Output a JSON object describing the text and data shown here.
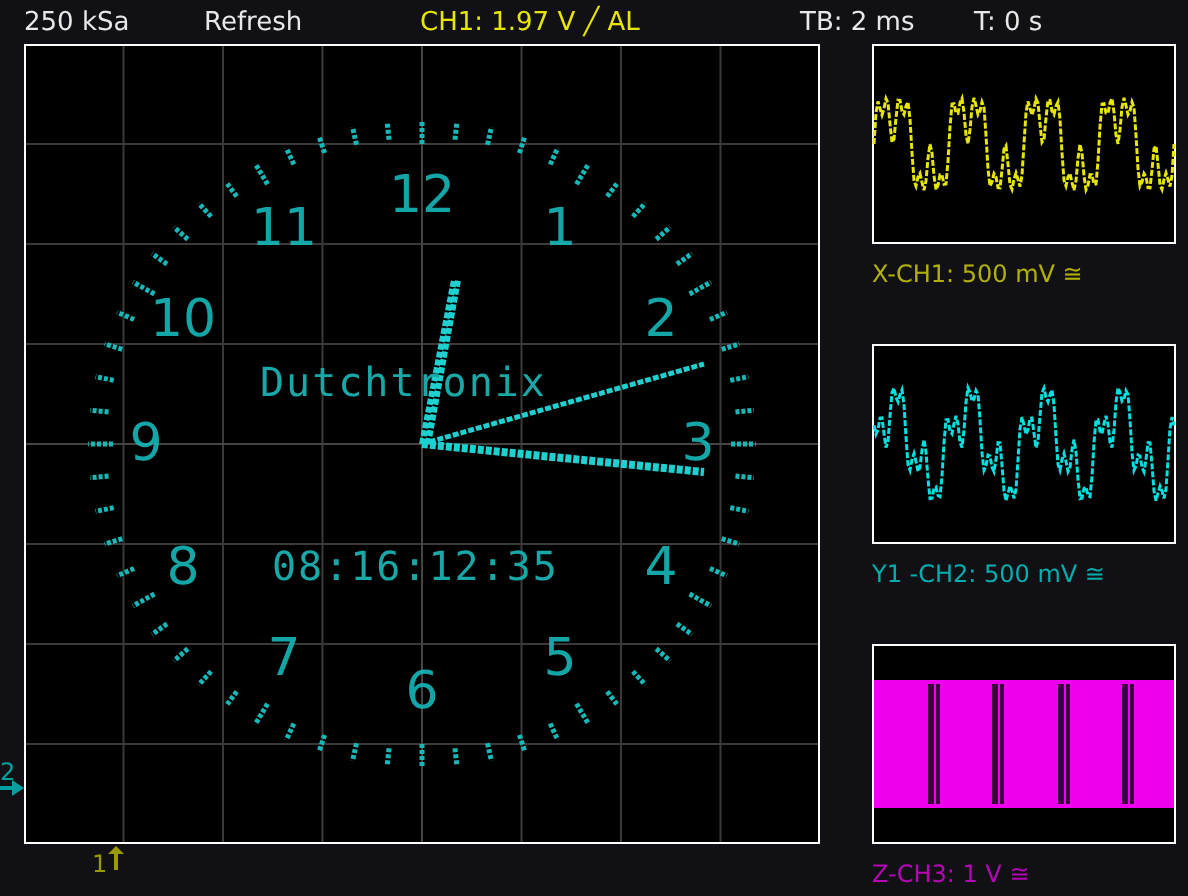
{
  "status_bar": [
    {
      "text": "250 kSa",
      "color": "#e8e8e8"
    },
    {
      "text": "Refresh",
      "color": "#e8e8e8"
    },
    {
      "text": "CH1: 1.97 V ╱ AL",
      "color": "#e6e600"
    },
    {
      "text": "TB: 2 ms",
      "color": "#e8e8e8"
    },
    {
      "text": "T: 0 s",
      "color": "#e8e8e8"
    }
  ],
  "xy_display": {
    "numerals": [
      "1",
      "2",
      "3",
      "4",
      "5",
      "6",
      "7",
      "8",
      "9",
      "10",
      "11",
      "12"
    ],
    "brand": "Dutchtronix",
    "time": "08:16:12:35"
  },
  "channels": [
    {
      "label": "X-CH1: 500 mV ≅",
      "color": "#e6e600",
      "kind": "wave"
    },
    {
      "label": "Y1 -CH2: 500 mV ≅",
      "color": "#00e0e0",
      "kind": "wave"
    },
    {
      "label": "Z-CH3: 1 V ≅",
      "color": "#ee00ee",
      "kind": "band"
    }
  ],
  "markers": [
    {
      "text": "2",
      "color": "#00a0a0"
    },
    {
      "text": "1",
      "color": "#9a9a00"
    }
  ]
}
